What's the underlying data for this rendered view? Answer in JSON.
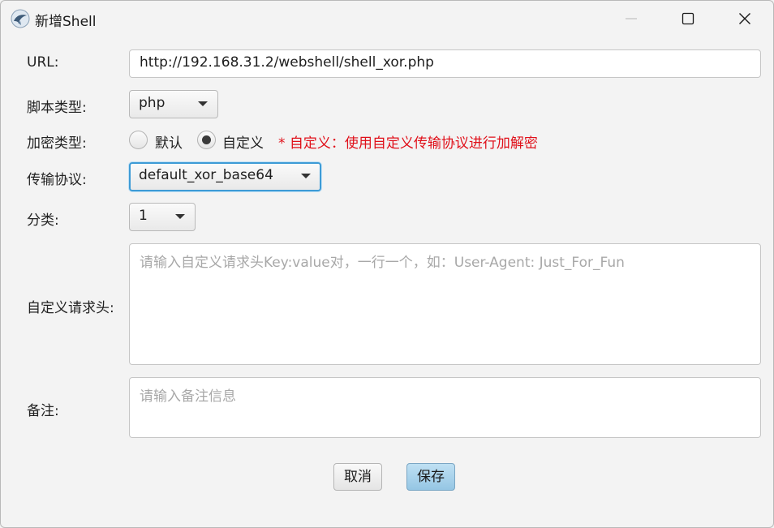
{
  "window": {
    "title": "新增Shell",
    "icon": "app-logo-icon"
  },
  "form": {
    "url": {
      "label": "URL:",
      "value": "http://192.168.31.2/webshell/shell_xor.php"
    },
    "script_type": {
      "label": "脚本类型:",
      "selected": "php"
    },
    "encryption": {
      "label": "加密类型:",
      "options": [
        {
          "label": "默认",
          "checked": false
        },
        {
          "label": "自定义",
          "checked": true
        }
      ],
      "hint": "* 自定义：使用自定义传输协议进行加解密"
    },
    "protocol": {
      "label": "传输协议:",
      "selected": "default_xor_base64"
    },
    "category": {
      "label": "分类:",
      "selected": "1"
    },
    "headers": {
      "label": "自定义请求头:",
      "placeholder": "请输入自定义请求头Key:value对，一行一个，如：User-Agent: Just_For_Fun"
    },
    "remark": {
      "label": "备注:",
      "placeholder": "请输入备注信息"
    }
  },
  "buttons": {
    "cancel": "取消",
    "save": "保存"
  },
  "colors": {
    "hint": "#e0101a",
    "focus": "#3d9bd6",
    "save_button": "#a9d3ec"
  }
}
